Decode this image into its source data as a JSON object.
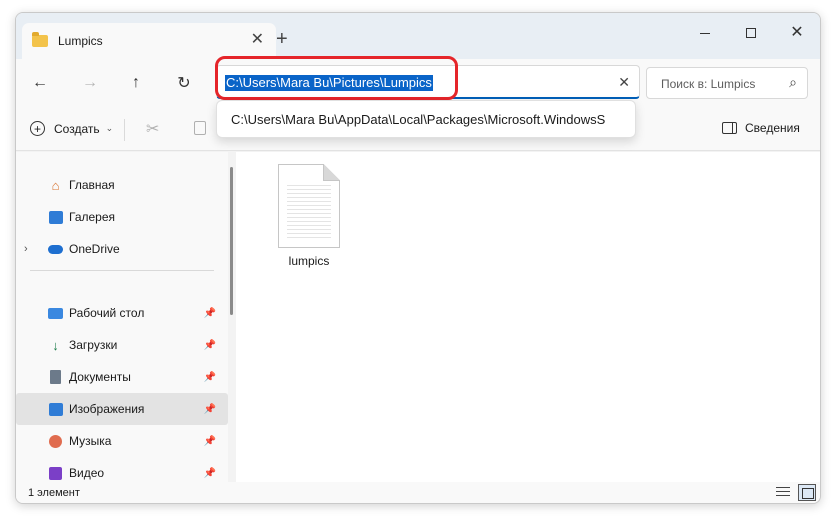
{
  "window": {
    "tab_title": "Lumpics",
    "tab_close": "✕",
    "new_tab": "+",
    "minimize": "",
    "maximize": "",
    "close": "✕"
  },
  "nav": {
    "back": "←",
    "forward": "→",
    "up": "↑",
    "refresh": "↻",
    "address_value": "C:\\Users\\Mara Bu\\Pictures\\Lumpics",
    "address_clear": "✕",
    "search_placeholder": "Поиск в: Lumpics",
    "search_icon": "⌕"
  },
  "suggestions": [
    "C:\\Users\\Mara Bu\\AppData\\Local\\Packages\\Microsoft.WindowsS"
  ],
  "toolbar": {
    "create_label": "Создать",
    "cut_icon": "✂",
    "details_label": "Сведения"
  },
  "sidebar": {
    "items": [
      {
        "label": "Главная",
        "icon": "home-icon"
      },
      {
        "label": "Галерея",
        "icon": "gallery-icon"
      },
      {
        "label": "OneDrive",
        "icon": "cloud-icon"
      },
      {
        "label": "Рабочий стол",
        "icon": "desktop-icon"
      },
      {
        "label": "Загрузки",
        "icon": "download-icon"
      },
      {
        "label": "Документы",
        "icon": "documents-icon"
      },
      {
        "label": "Изображения",
        "icon": "pictures-icon",
        "selected": true
      },
      {
        "label": "Музыка",
        "icon": "music-icon"
      },
      {
        "label": "Видео",
        "icon": "video-icon"
      }
    ]
  },
  "content": {
    "files": [
      {
        "name": "lumpics"
      }
    ]
  },
  "status": {
    "count": "1 элемент"
  },
  "colors": {
    "accent": "#005fb8",
    "highlight": "#e5252a",
    "selection": "#0a64c8"
  }
}
